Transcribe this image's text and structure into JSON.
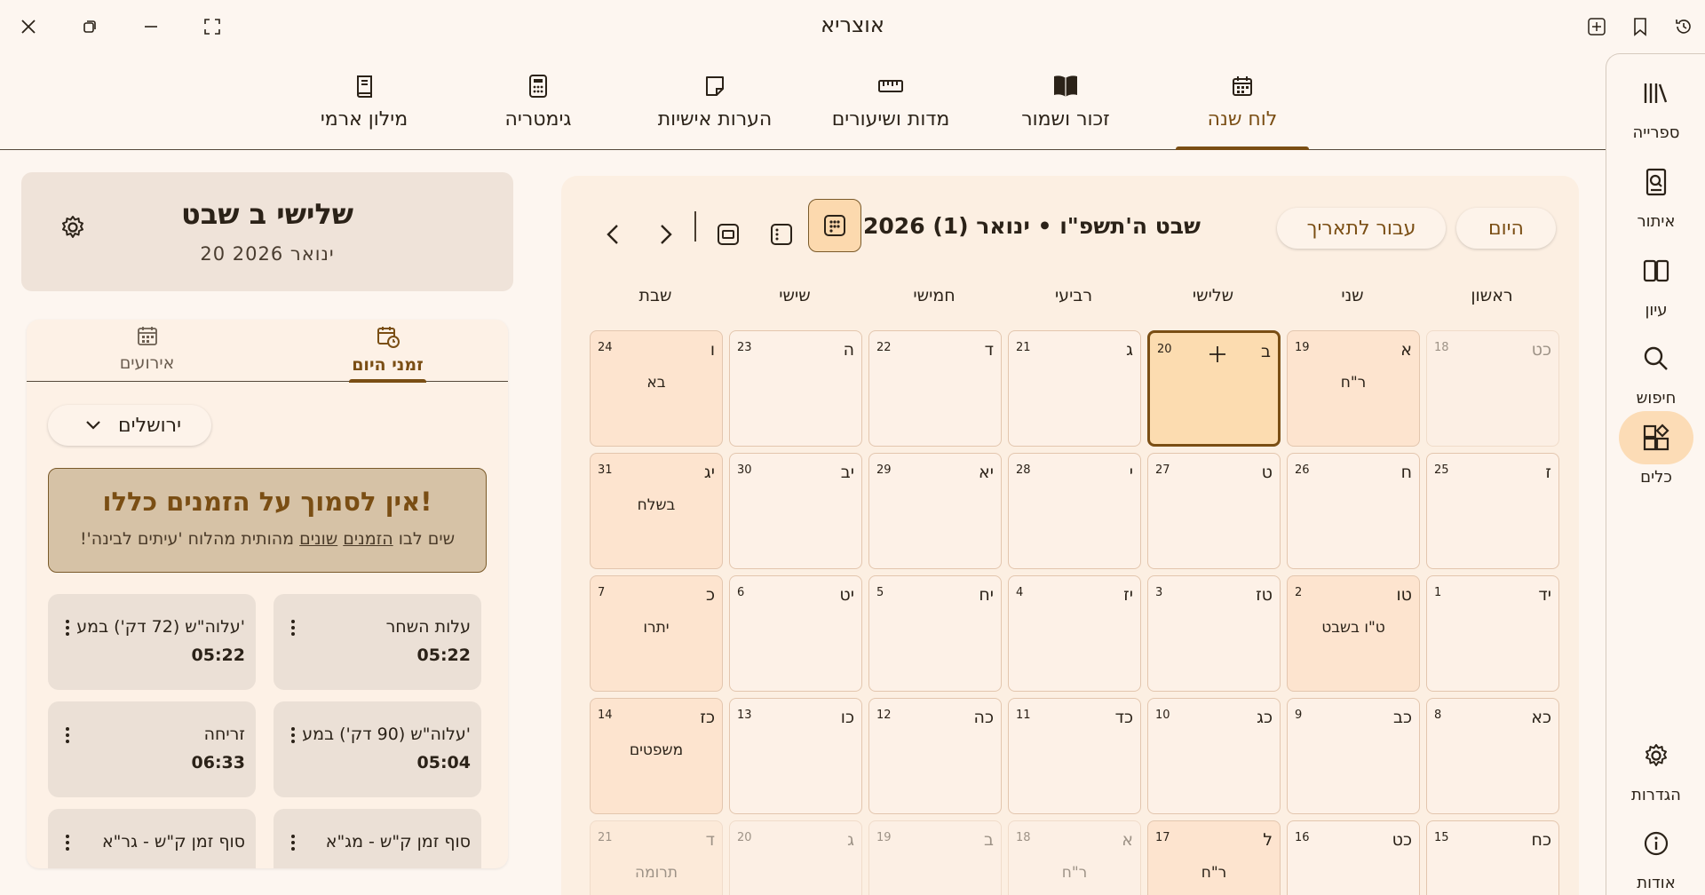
{
  "app": {
    "title": "אוצריא"
  },
  "titlebar": {
    "left_icons": [
      "close-icon",
      "restore-icon",
      "minimize-icon",
      "fullscreen-icon"
    ],
    "right_icons": [
      "add-tab-icon",
      "bookmark-icon",
      "history-icon"
    ]
  },
  "tabs": [
    {
      "label": "לוח שנה",
      "icon": "calendar-icon",
      "active": true
    },
    {
      "label": "זכור ושמור",
      "icon": "open-book-icon"
    },
    {
      "label": "מדות ושיעורים",
      "icon": "ruler-icon"
    },
    {
      "label": "הערות אישיות",
      "icon": "note-icon"
    },
    {
      "label": "גימטריה",
      "icon": "calculator-icon"
    },
    {
      "label": "מילון ארמי",
      "icon": "dictionary-icon"
    }
  ],
  "rail": [
    {
      "label": "ספרייה",
      "icon": "library-icon"
    },
    {
      "label": "איתור",
      "icon": "find-book-icon"
    },
    {
      "label": "עיון",
      "icon": "reading-icon"
    },
    {
      "label": "חיפוש",
      "icon": "search-icon"
    },
    {
      "label": "כלים",
      "icon": "tools-icon",
      "active": true
    },
    {
      "label": "הגדרות",
      "icon": "settings-icon"
    },
    {
      "label": "אודות",
      "icon": "info-icon"
    }
  ],
  "day_header": {
    "title": "שלישי ב שבט",
    "subtitle": "20 ינואר 2026"
  },
  "zmanim_tabs": [
    {
      "label": "זמני היום",
      "active": true
    },
    {
      "label": "אירועים"
    }
  ],
  "location": "ירושלים",
  "warning": {
    "title": "אין לסמוך על הזמנים כללו!",
    "body_prefix": "שים לבו",
    "link1": "הזמנים",
    "link2": "שונים",
    "body_suffix": "מהותית מהלוח 'עיתים לבינה'!"
  },
  "zmanim": [
    {
      "name": "עלות השחר",
      "time": "05:22"
    },
    {
      "name": "עלוה\"ש (72 דק') במע'",
      "time": "05:22"
    },
    {
      "name": "עלוה\"ש (90 דק') במע'",
      "time": "05:04"
    },
    {
      "name": "זריחה",
      "time": "06:33"
    },
    {
      "name": "סוף זמן ק\"ש - מג\"א",
      "time": ""
    },
    {
      "name": "סוף זמן ק\"ש - גר\"א",
      "time": ""
    }
  ],
  "calendar": {
    "today_label": "היום",
    "goto_label": "עבור לתאריך",
    "title": "שבט ה'תשפ\"ו • ינואר (1) 2026",
    "weekdays": [
      "ראשון",
      "שני",
      "שלישי",
      "רביעי",
      "חמישי",
      "שישי",
      "שבת"
    ],
    "weeks": [
      [
        {
          "h": "כט",
          "g": "18",
          "e": "",
          "out": true
        },
        {
          "h": "א",
          "g": "19",
          "e": "ר\"ח",
          "hol": true
        },
        {
          "h": "ב",
          "g": "20",
          "e": "",
          "today": true
        },
        {
          "h": "ג",
          "g": "21",
          "e": ""
        },
        {
          "h": "ד",
          "g": "22",
          "e": ""
        },
        {
          "h": "ה",
          "g": "23",
          "e": ""
        },
        {
          "h": "ו",
          "g": "24",
          "e": "בא"
        }
      ],
      [
        {
          "h": "ז",
          "g": "25",
          "e": ""
        },
        {
          "h": "ח",
          "g": "26",
          "e": ""
        },
        {
          "h": "ט",
          "g": "27",
          "e": ""
        },
        {
          "h": "י",
          "g": "28",
          "e": ""
        },
        {
          "h": "יא",
          "g": "29",
          "e": ""
        },
        {
          "h": "יב",
          "g": "30",
          "e": ""
        },
        {
          "h": "יג",
          "g": "31",
          "e": "בשלח"
        }
      ],
      [
        {
          "h": "יד",
          "g": "1",
          "e": ""
        },
        {
          "h": "טו",
          "g": "2",
          "e": "ט\"ו בשבט",
          "hol": true
        },
        {
          "h": "טז",
          "g": "3",
          "e": ""
        },
        {
          "h": "יז",
          "g": "4",
          "e": ""
        },
        {
          "h": "יח",
          "g": "5",
          "e": ""
        },
        {
          "h": "יט",
          "g": "6",
          "e": ""
        },
        {
          "h": "כ",
          "g": "7",
          "e": "יתרו"
        }
      ],
      [
        {
          "h": "כא",
          "g": "8",
          "e": ""
        },
        {
          "h": "כב",
          "g": "9",
          "e": ""
        },
        {
          "h": "כג",
          "g": "10",
          "e": ""
        },
        {
          "h": "כד",
          "g": "11",
          "e": ""
        },
        {
          "h": "כה",
          "g": "12",
          "e": ""
        },
        {
          "h": "כו",
          "g": "13",
          "e": ""
        },
        {
          "h": "כז",
          "g": "14",
          "e": "משפטים"
        }
      ],
      [
        {
          "h": "כח",
          "g": "15",
          "e": ""
        },
        {
          "h": "כט",
          "g": "16",
          "e": ""
        },
        {
          "h": "ל",
          "g": "17",
          "e": "ר\"ח",
          "hol": true
        },
        {
          "h": "א",
          "g": "18",
          "e": "ר\"ח",
          "out": true
        },
        {
          "h": "ב",
          "g": "19",
          "e": "",
          "out": true
        },
        {
          "h": "ג",
          "g": "20",
          "e": "",
          "out": true
        },
        {
          "h": "ד",
          "g": "21",
          "e": "תרומה",
          "out": true
        }
      ]
    ]
  }
}
